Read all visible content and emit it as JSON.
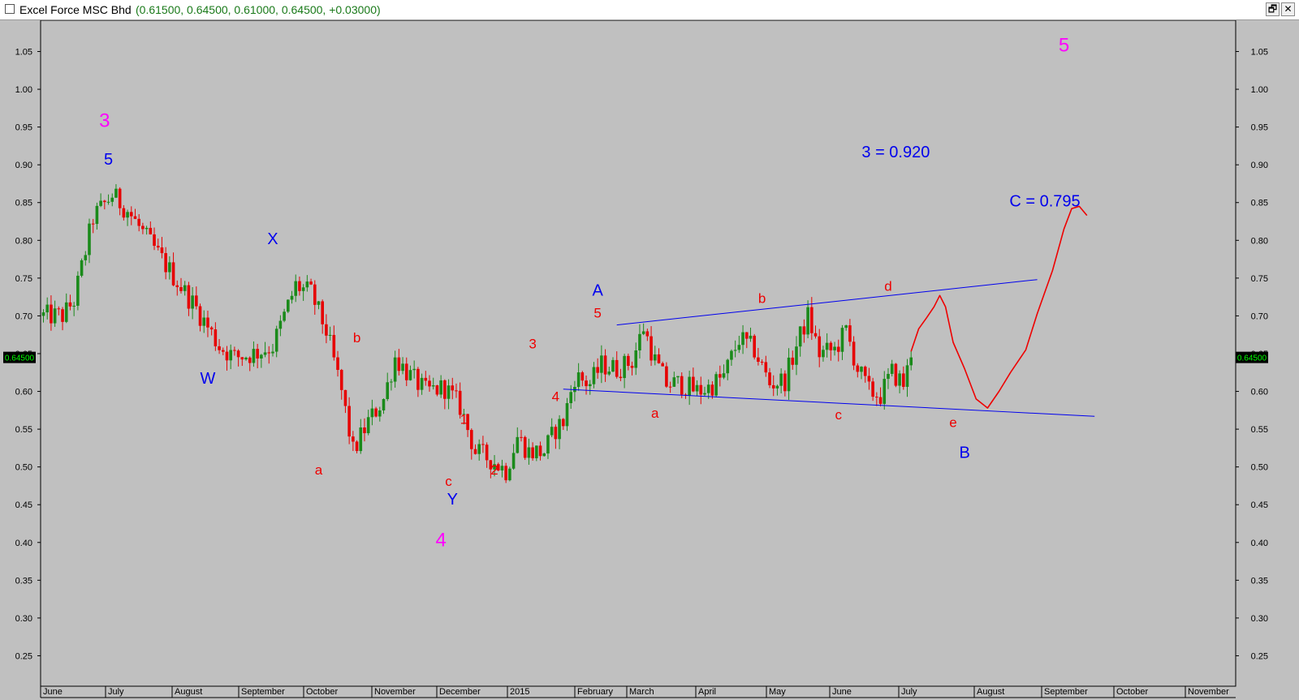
{
  "window": {
    "title": "Excel Force MSC Bhd",
    "quote": "(0.61500, 0.64500, 0.61000, 0.64500, +0.03000)",
    "restore_label": "🗗",
    "close_label": "✕"
  },
  "chart_data": {
    "type": "candlestick",
    "title": "Excel Force MSC Bhd",
    "ylim": [
      0.23,
      1.09
    ],
    "y_ticks": [
      "1.05",
      "1.00",
      "0.95",
      "0.90",
      "0.85",
      "0.80",
      "0.75",
      "0.70",
      "0.65",
      "0.60",
      "0.55",
      "0.50",
      "0.45",
      "0.40",
      "0.35",
      "0.30",
      "0.25"
    ],
    "last_price": "0.64500",
    "x_month_labels": [
      "June",
      "July",
      "August",
      "September",
      "October",
      "November",
      "December",
      "2015",
      "February",
      "March",
      "April",
      "May",
      "June",
      "July",
      "August",
      "September",
      "October",
      "November"
    ],
    "colors": {
      "up": "#1a8a1a",
      "down": "#e60000",
      "trendline": "#0000ee",
      "projection": "#ee0000",
      "background": "#c0c0c0"
    },
    "candle_anchors": [
      {
        "t": 0,
        "p": 0.7
      },
      {
        "t": 5,
        "p": 0.7
      },
      {
        "t": 8,
        "p": 0.72
      },
      {
        "t": 13,
        "p": 0.83
      },
      {
        "t": 18,
        "p": 0.86
      },
      {
        "t": 22,
        "p": 0.84
      },
      {
        "t": 26,
        "p": 0.81
      },
      {
        "t": 33,
        "p": 0.76
      },
      {
        "t": 40,
        "p": 0.71
      },
      {
        "t": 46,
        "p": 0.66
      },
      {
        "t": 50,
        "p": 0.645
      },
      {
        "t": 55,
        "p": 0.65
      },
      {
        "t": 60,
        "p": 0.66
      },
      {
        "t": 66,
        "p": 0.74
      },
      {
        "t": 70,
        "p": 0.73
      },
      {
        "t": 74,
        "p": 0.68
      },
      {
        "t": 78,
        "p": 0.6
      },
      {
        "t": 81,
        "p": 0.52
      },
      {
        "t": 85,
        "p": 0.56
      },
      {
        "t": 89,
        "p": 0.59
      },
      {
        "t": 92,
        "p": 0.645
      },
      {
        "t": 96,
        "p": 0.62
      },
      {
        "t": 100,
        "p": 0.6
      },
      {
        "t": 105,
        "p": 0.605
      },
      {
        "t": 109,
        "p": 0.58
      },
      {
        "t": 113,
        "p": 0.52
      },
      {
        "t": 117,
        "p": 0.51
      },
      {
        "t": 121,
        "p": 0.495
      },
      {
        "t": 124,
        "p": 0.54
      },
      {
        "t": 127,
        "p": 0.52
      },
      {
        "t": 131,
        "p": 0.52
      },
      {
        "t": 134,
        "p": 0.55
      },
      {
        "t": 136,
        "p": 0.56
      },
      {
        "t": 139,
        "p": 0.62
      },
      {
        "t": 143,
        "p": 0.61
      },
      {
        "t": 146,
        "p": 0.635
      },
      {
        "t": 150,
        "p": 0.63
      },
      {
        "t": 154,
        "p": 0.64
      },
      {
        "t": 157,
        "p": 0.685
      },
      {
        "t": 160,
        "p": 0.64
      },
      {
        "t": 163,
        "p": 0.61
      },
      {
        "t": 167,
        "p": 0.61
      },
      {
        "t": 171,
        "p": 0.6
      },
      {
        "t": 174,
        "p": 0.605
      },
      {
        "t": 178,
        "p": 0.62
      },
      {
        "t": 182,
        "p": 0.67
      },
      {
        "t": 186,
        "p": 0.655
      },
      {
        "t": 190,
        "p": 0.61
      },
      {
        "t": 194,
        "p": 0.615
      },
      {
        "t": 197,
        "p": 0.66
      },
      {
        "t": 200,
        "p": 0.7
      },
      {
        "t": 203,
        "p": 0.65
      },
      {
        "t": 207,
        "p": 0.655
      },
      {
        "t": 210,
        "p": 0.68
      },
      {
        "t": 213,
        "p": 0.63
      },
      {
        "t": 216,
        "p": 0.6
      },
      {
        "t": 219,
        "p": 0.595
      },
      {
        "t": 222,
        "p": 0.625
      },
      {
        "t": 225,
        "p": 0.61
      },
      {
        "t": 227,
        "p": 0.645
      }
    ],
    "trendlines": [
      {
        "from_t": 150,
        "from_p": 0.688,
        "to_t": 260,
        "to_p": 0.748
      },
      {
        "from_t": 136,
        "from_p": 0.603,
        "to_t": 275,
        "to_p": 0.567
      }
    ],
    "projection": [
      {
        "t": 227,
        "p": 0.653
      },
      {
        "t": 229,
        "p": 0.683
      },
      {
        "t": 231,
        "p": 0.697
      },
      {
        "t": 233,
        "p": 0.712
      },
      {
        "t": 234.5,
        "p": 0.727
      },
      {
        "t": 236,
        "p": 0.712
      },
      {
        "t": 238,
        "p": 0.665
      },
      {
        "t": 241,
        "p": 0.63
      },
      {
        "t": 244,
        "p": 0.59
      },
      {
        "t": 247,
        "p": 0.578
      },
      {
        "t": 250,
        "p": 0.6
      },
      {
        "t": 253,
        "p": 0.625
      },
      {
        "t": 257,
        "p": 0.655
      },
      {
        "t": 260,
        "p": 0.703
      },
      {
        "t": 264,
        "p": 0.76
      },
      {
        "t": 267,
        "p": 0.815
      },
      {
        "t": 269,
        "p": 0.842
      },
      {
        "t": 271,
        "p": 0.845
      },
      {
        "t": 273,
        "p": 0.833
      }
    ],
    "wave_labels": [
      {
        "text": "3",
        "t": 16,
        "p": 0.95,
        "color": "#ff00ff",
        "size": 24
      },
      {
        "text": "5",
        "t": 17,
        "p": 0.9,
        "color": "#0000ee",
        "size": 20
      },
      {
        "text": "W",
        "t": 43,
        "p": 0.61,
        "color": "#0000ee",
        "size": 20
      },
      {
        "text": "X",
        "t": 60,
        "p": 0.795,
        "color": "#0000ee",
        "size": 20
      },
      {
        "text": "a",
        "t": 72,
        "p": 0.49,
        "color": "#ee0000",
        "size": 17
      },
      {
        "text": "b",
        "t": 82,
        "p": 0.665,
        "color": "#ee0000",
        "size": 17
      },
      {
        "text": "c",
        "t": 106,
        "p": 0.475,
        "color": "#ee0000",
        "size": 17
      },
      {
        "text": "Y",
        "t": 107,
        "p": 0.45,
        "color": "#0000ee",
        "size": 20
      },
      {
        "text": "4",
        "t": 104,
        "p": 0.395,
        "color": "#ff00ff",
        "size": 24
      },
      {
        "text": "1",
        "t": 110,
        "p": 0.557,
        "color": "#ee0000",
        "size": 17
      },
      {
        "text": "2",
        "t": 118,
        "p": 0.49,
        "color": "#ee0000",
        "size": 17
      },
      {
        "text": "3",
        "t": 128,
        "p": 0.657,
        "color": "#ee0000",
        "size": 17
      },
      {
        "text": "4",
        "t": 134,
        "p": 0.587,
        "color": "#ee0000",
        "size": 17
      },
      {
        "text": "A",
        "t": 145,
        "p": 0.727,
        "color": "#0000ee",
        "size": 20
      },
      {
        "text": "5",
        "t": 145,
        "p": 0.698,
        "color": "#ee0000",
        "size": 17
      },
      {
        "text": "a",
        "t": 160,
        "p": 0.565,
        "color": "#ee0000",
        "size": 17
      },
      {
        "text": "b",
        "t": 188,
        "p": 0.717,
        "color": "#ee0000",
        "size": 17
      },
      {
        "text": "c",
        "t": 208,
        "p": 0.563,
        "color": "#ee0000",
        "size": 17
      },
      {
        "text": "d",
        "t": 221,
        "p": 0.733,
        "color": "#ee0000",
        "size": 17
      },
      {
        "text": "e",
        "t": 238,
        "p": 0.553,
        "color": "#ee0000",
        "size": 17
      },
      {
        "text": "B",
        "t": 241,
        "p": 0.512,
        "color": "#0000ee",
        "size": 20
      },
      {
        "text": "3 = 0.920",
        "t": 223,
        "p": 0.91,
        "color": "#0000ee",
        "size": 20
      },
      {
        "text": "C = 0.795",
        "t": 262,
        "p": 0.845,
        "color": "#0000ee",
        "size": 20
      },
      {
        "text": "5",
        "t": 267,
        "p": 1.05,
        "color": "#ff00ff",
        "size": 24
      }
    ]
  }
}
